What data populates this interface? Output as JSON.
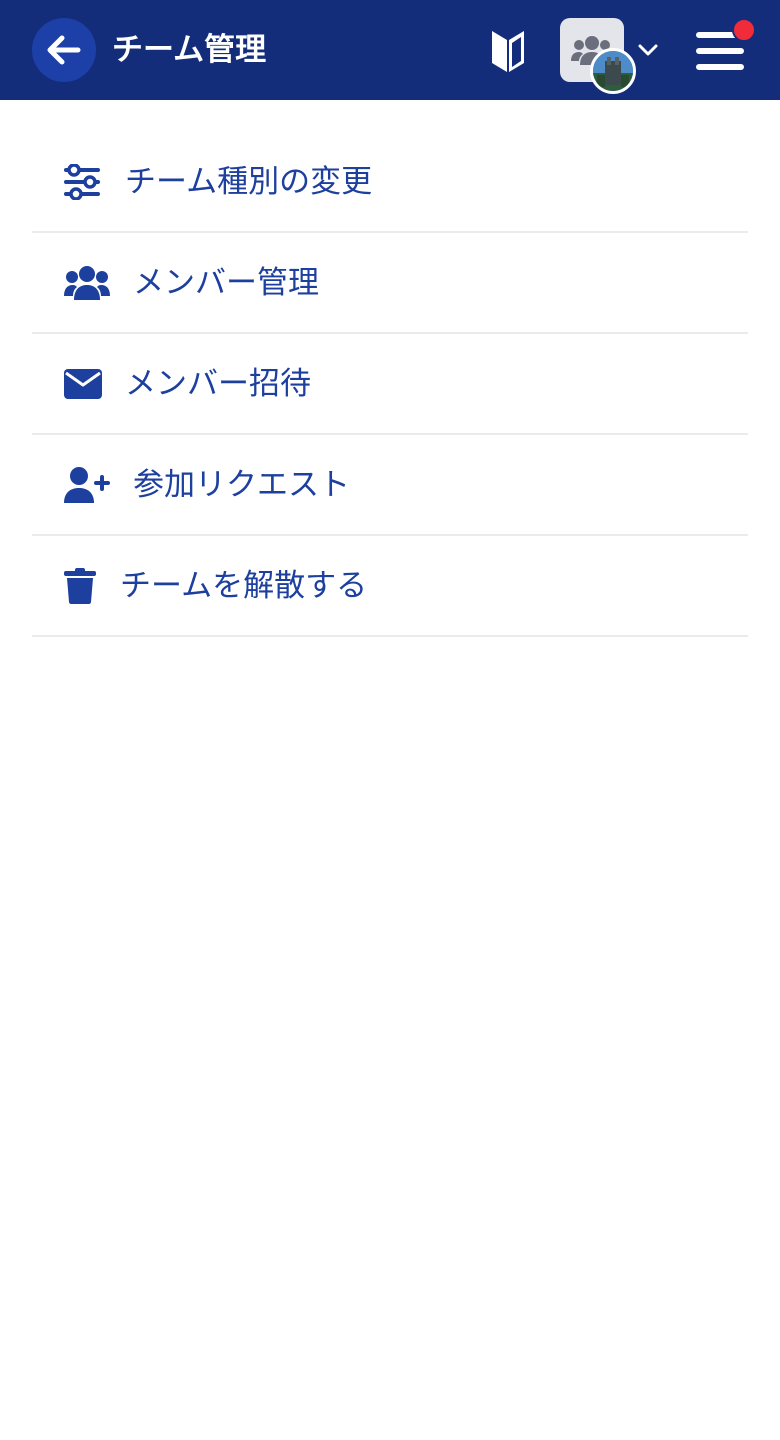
{
  "header": {
    "title": "チーム管理",
    "icons": {
      "back": "arrow-left-icon",
      "beginner": "beginner-mark-icon",
      "team": "users-icon",
      "chevron": "chevron-down-icon",
      "menu": "hamburger-menu-icon"
    },
    "has_notification": true
  },
  "menu": {
    "items": [
      {
        "label": "チーム種別の変更",
        "icon": "sliders-icon"
      },
      {
        "label": "メンバー管理",
        "icon": "users-icon"
      },
      {
        "label": "メンバー招待",
        "icon": "envelope-icon"
      },
      {
        "label": "参加リクエスト",
        "icon": "user-plus-icon"
      },
      {
        "label": "チームを解散する",
        "icon": "trash-icon"
      }
    ]
  },
  "colors": {
    "header_bg": "#142d7a",
    "accent": "#1d3f9e",
    "notification": "#f02b3a",
    "divider": "#ebebeb"
  }
}
